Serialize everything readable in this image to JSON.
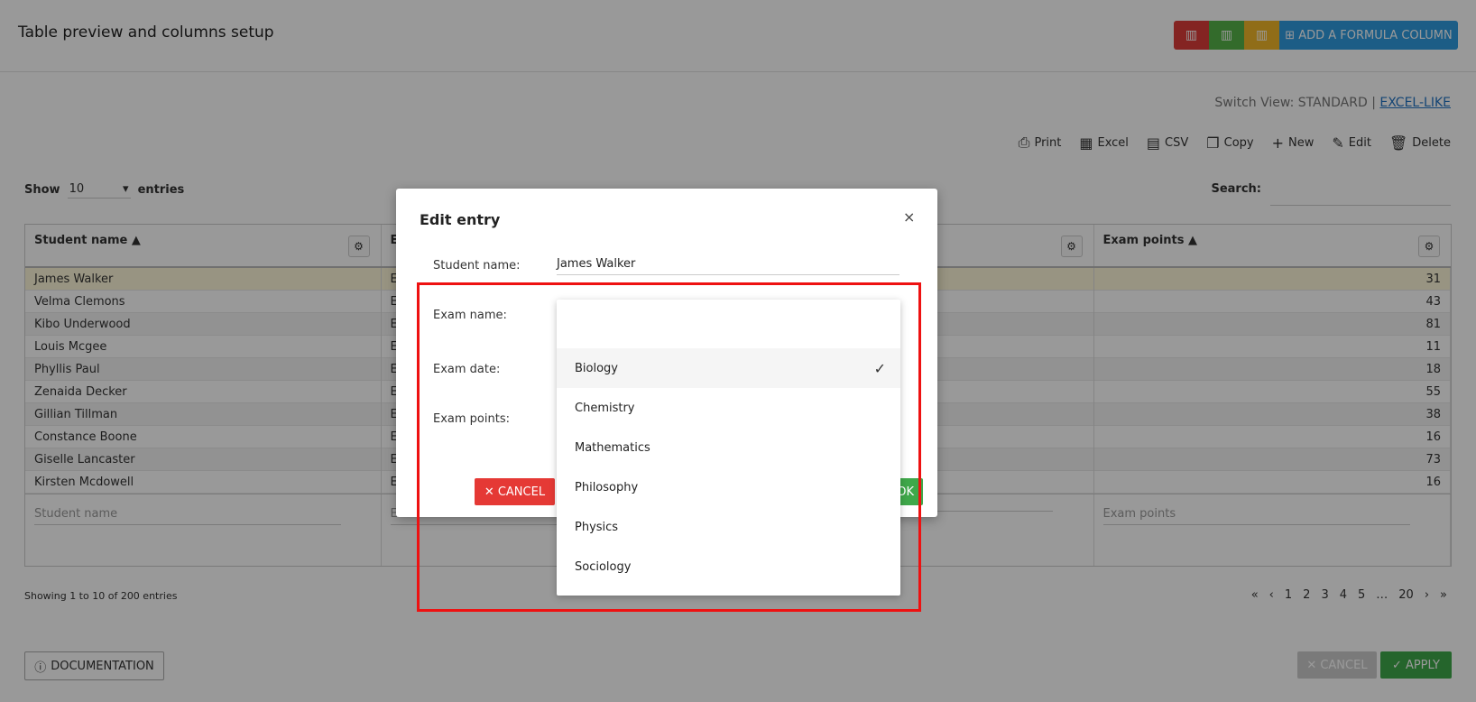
{
  "header": {
    "title": "Table preview and columns setup",
    "formula_button": "ADD A FORMULA COLUMN"
  },
  "switch_view": {
    "label": "Switch View: STANDARD |",
    "excel_like": "EXCEL-LIKE"
  },
  "toolbar": {
    "print": "Print",
    "excel": "Excel",
    "csv": "CSV",
    "copy": "Copy",
    "new": "New",
    "edit": "Edit",
    "delete": "Delete"
  },
  "length": {
    "show": "Show",
    "value": "10",
    "entries": "entries"
  },
  "search": {
    "label": "Search:"
  },
  "table": {
    "columns": [
      "Student name",
      "E",
      "",
      "Exam points"
    ],
    "rows": [
      {
        "name": "James Walker",
        "exam": "E",
        "points": "31"
      },
      {
        "name": "Velma Clemons",
        "exam": "E",
        "points": "43"
      },
      {
        "name": "Kibo Underwood",
        "exam": "E",
        "points": "81"
      },
      {
        "name": "Louis Mcgee",
        "exam": "E",
        "points": "11"
      },
      {
        "name": "Phyllis Paul",
        "exam": "E",
        "points": "18"
      },
      {
        "name": "Zenaida Decker",
        "exam": "E",
        "points": "55"
      },
      {
        "name": "Gillian Tillman",
        "exam": "E",
        "points": "38"
      },
      {
        "name": "Constance Boone",
        "exam": "E",
        "points": "16"
      },
      {
        "name": "Giselle Lancaster",
        "exam": "E",
        "points": "73"
      },
      {
        "name": "Kirsten Mcdowell",
        "exam": "E",
        "points": "16"
      }
    ],
    "filters": [
      "Student name",
      "Exam name",
      "",
      "Exam points"
    ]
  },
  "info": "Showing 1 to 10 of 200 entries",
  "pager": {
    "first": "«",
    "prev": "‹",
    "pages": [
      "1",
      "2",
      "3",
      "4",
      "5",
      "…",
      "20"
    ],
    "next": "›",
    "last": "»"
  },
  "footer": {
    "documentation": "DOCUMENTATION",
    "cancel": "CANCEL",
    "apply": "APPLY"
  },
  "modal": {
    "title": "Edit entry",
    "close": "×",
    "fields": {
      "student_label": "Student name:",
      "student_value": "James Walker",
      "exam_label": "Exam name:",
      "date_label": "Exam date:",
      "points_label": "Exam points:"
    },
    "cancel": "CANCEL",
    "ok": "OK"
  },
  "dropdown": {
    "options": [
      "Biology",
      "Chemistry",
      "Mathematics",
      "Philosophy",
      "Physics",
      "Sociology"
    ],
    "selected": "Biology"
  },
  "colors": {
    "highlight": "#ee1111",
    "apply": "#3fa84a",
    "cancel": "#e53935",
    "formula": "#2f9be0"
  }
}
